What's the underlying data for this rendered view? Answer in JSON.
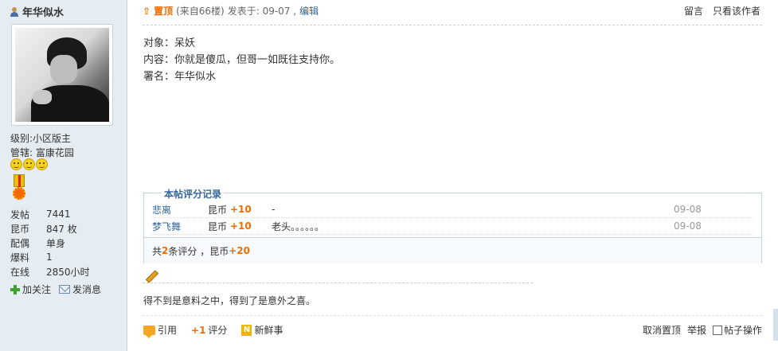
{
  "author": {
    "name": "年华似水"
  },
  "profile": {
    "level_label": "级别:",
    "level_value": "小区版主",
    "manage_label": "管辖:",
    "manage_value": "富康花园",
    "stats": [
      {
        "label": "发帖",
        "value": "7441"
      },
      {
        "label": "昆币",
        "value": "847 枚"
      },
      {
        "label": "配偶",
        "value": "单身"
      },
      {
        "label": "爆料",
        "value": "1"
      },
      {
        "label": "在线",
        "value": "2850小时"
      }
    ],
    "follow_label": "加关注",
    "message_label": "发消息"
  },
  "post_header": {
    "sticky_icon": "⇧",
    "sticky_label": "置顶",
    "from_floor": "(来自66楼)",
    "posted_at": "发表于: 09-07 ,",
    "edit_label": "编辑",
    "reply_label": "留言",
    "only_author_label": "只看该作者"
  },
  "post_body": {
    "lines": [
      "对象：呆妖",
      "内容：你就是傻瓜，但哥一如既往支持你。",
      "署名：年华似水"
    ]
  },
  "rating": {
    "title": "本帖评分记录",
    "rows": [
      {
        "user": "悲离",
        "currency": "昆币",
        "amount": "+10",
        "reason": "-",
        "date": "09-08"
      },
      {
        "user": "梦飞舞",
        "currency": "昆币",
        "amount": "+10",
        "reason": "老头。。。。。。",
        "date": "09-08"
      }
    ],
    "summary_prefix": "共",
    "summary_count": "2",
    "summary_mid": "条评分 ，昆币",
    "summary_total": "+20"
  },
  "signature": "得不到是意料之中，得到了是意外之喜。",
  "actions": {
    "quote_label": "引用",
    "rate_icon": "+1",
    "rate_label": "评分",
    "news_icon": "N",
    "news_label": "新鲜事",
    "unsticky_label": "取消置顶",
    "report_label": "举报",
    "post_manage_label": "帖子操作"
  },
  "colors": {
    "sidebar_bg": "#e5edf2",
    "accent_orange": "#f26c00",
    "link_blue": "#336699",
    "border_blue": "#c2d5e3"
  }
}
